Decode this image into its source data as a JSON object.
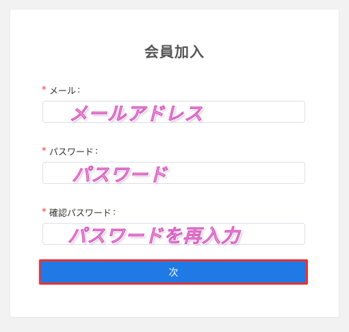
{
  "form": {
    "title": "会員加入",
    "required_mark": "*",
    "colon": ":",
    "fields": [
      {
        "label": "メール",
        "value": "",
        "overlay": "メールアドレス"
      },
      {
        "label": "パスワード",
        "value": "",
        "overlay": "パスワード"
      },
      {
        "label": "確認パスワード",
        "value": "",
        "overlay": "パスワードを再入力"
      }
    ],
    "next_label": "次"
  },
  "colors": {
    "primary_button": "#1f7ae6",
    "highlight_border": "#f2302c",
    "required_asterisk": "#f56c6c",
    "overlay_text": "#f9a8e6"
  }
}
